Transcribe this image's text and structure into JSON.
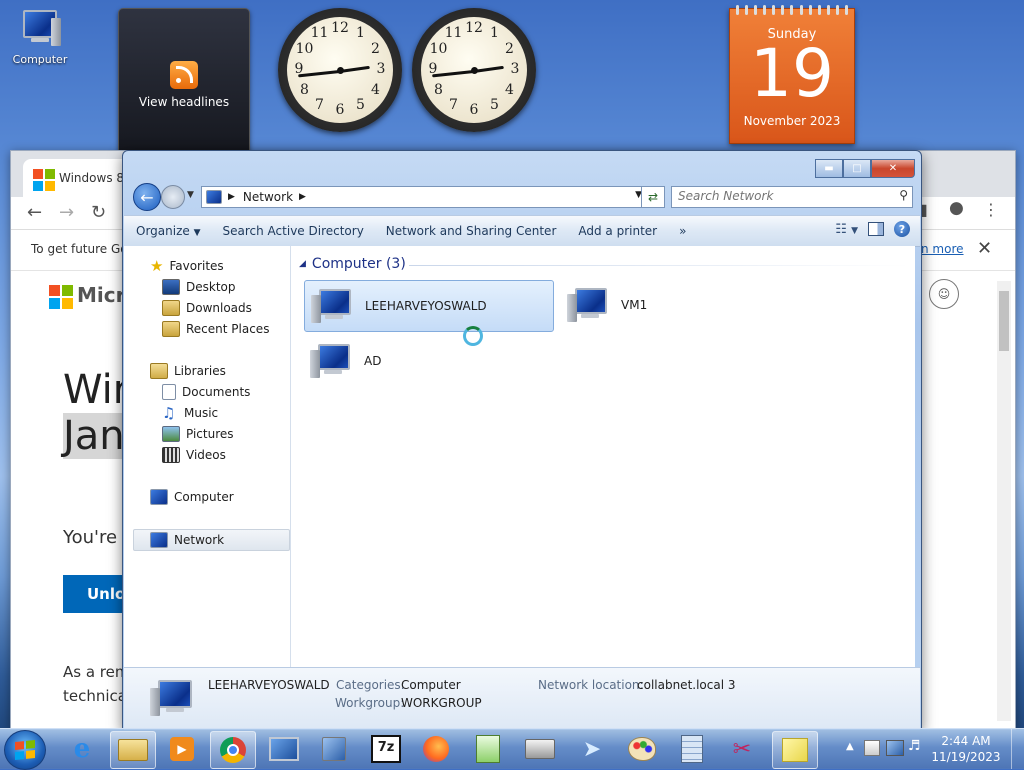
{
  "desktop": {
    "computer_icon_label": "Computer",
    "headlines_label": "View headlines"
  },
  "clocks": [
    {
      "numerals": [
        "12",
        "1",
        "2",
        "3",
        "4",
        "5",
        "6",
        "7",
        "8",
        "9",
        "10",
        "11"
      ],
      "time": "2:44"
    },
    {
      "numerals": [
        "12",
        "1",
        "2",
        "3",
        "4",
        "5",
        "6",
        "7",
        "8",
        "9",
        "10",
        "11"
      ],
      "time": "2:44"
    }
  ],
  "calendar": {
    "weekday": "Sunday",
    "day": "19",
    "month_year": "November 2023"
  },
  "browser": {
    "tab_title": "Windows 8.1",
    "info_text": "To get future Go",
    "info_link": "n more",
    "page_lines": [
      "Micro",
      "Wir",
      "Jan",
      "You're",
      "Unlo",
      "As a rem",
      "technica"
    ]
  },
  "explorer": {
    "address_crumb": "Network",
    "search_placeholder": "Search Network",
    "commands": [
      "Organize",
      "Search Active Directory",
      "Network and Sharing Center",
      "Add a printer",
      "»"
    ],
    "nav": {
      "favorites_header": "Favorites",
      "favorites": [
        "Desktop",
        "Downloads",
        "Recent Places"
      ],
      "libraries_header": "Libraries",
      "libraries": [
        "Documents",
        "Music",
        "Pictures",
        "Videos"
      ],
      "computer": "Computer",
      "network": "Network"
    },
    "group_header": "Computer (3)",
    "items": [
      {
        "name": "LEEHARVEYOSWALD",
        "selected": true
      },
      {
        "name": "VM1",
        "selected": false
      },
      {
        "name": "AD",
        "selected": false
      }
    ],
    "details": {
      "name": "LEEHARVEYOSWALD",
      "categories_label": "Categories:",
      "categories_value": "Computer",
      "workgroup_label": "Workgroup:",
      "workgroup_value": "WORKGROUP",
      "network_location_label": "Network location:",
      "network_location_value": "collabnet.local  3"
    }
  },
  "taskbar": {
    "time": "2:44 AM",
    "date": "11/19/2023",
    "apps": [
      "internet-explorer",
      "windows-explorer",
      "media-player",
      "chrome",
      "remote-desktop",
      "network-monitor",
      "7zip",
      "firefox",
      "notepad-plus-plus",
      "fax-scanner",
      "paper-plane",
      "paint",
      "calculator",
      "snipping-tool",
      "sticky-notes"
    ]
  },
  "colors": {
    "accent": "#1e3287",
    "calendar": "#e8672a",
    "selection": "#c5dcf7"
  }
}
